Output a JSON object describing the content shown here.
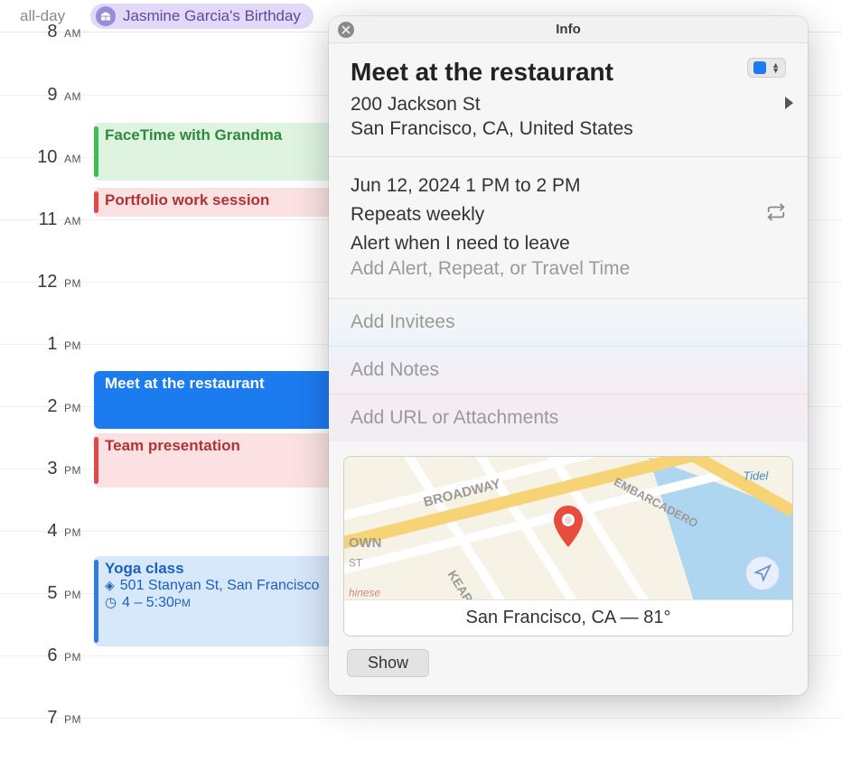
{
  "allday": {
    "label": "all-day",
    "event_title": "Jasmine Garcia's Birthday"
  },
  "hours": [
    "8 AM",
    "9 AM",
    "10 AM",
    "11 AM",
    "12 PM",
    "1 PM",
    "2 PM",
    "3 PM",
    "4 PM",
    "5 PM",
    "6 PM",
    "7 PM"
  ],
  "events": {
    "facetime": {
      "title": "FaceTime with Grandma"
    },
    "portfolio": {
      "title": "Portfolio work session"
    },
    "meet": {
      "title": "Meet at the restaurant"
    },
    "team": {
      "title": "Team presentation"
    },
    "yoga": {
      "title": "Yoga class",
      "location": "501 Stanyan St, San Francisco",
      "time": "4 – 5:30 PM"
    }
  },
  "popover": {
    "header": "Info",
    "title": "Meet at the restaurant",
    "address_line1": "200 Jackson St",
    "address_line2": "San Francisco, CA, United States",
    "datetime": "Jun 12, 2024  1 PM to 2 PM",
    "repeat": "Repeats weekly",
    "alert": "Alert when I need to leave",
    "add_alert_placeholder": "Add Alert, Repeat, or Travel Time",
    "add_invitees_placeholder": "Add Invitees",
    "add_notes_placeholder": "Add Notes",
    "add_url_placeholder": "Add URL or Attachments",
    "map_caption": "San Francisco, CA — 81°",
    "map_streets": {
      "broadway": "BROADWAY",
      "kearny": "KEARNY",
      "embarcadero": "EMBARCADERO",
      "st": "ST",
      "own": "OWN",
      "tidel": "Tidel",
      "hinese": "hinese"
    },
    "show_button": "Show",
    "calendar_color": "#1d7bf0"
  }
}
